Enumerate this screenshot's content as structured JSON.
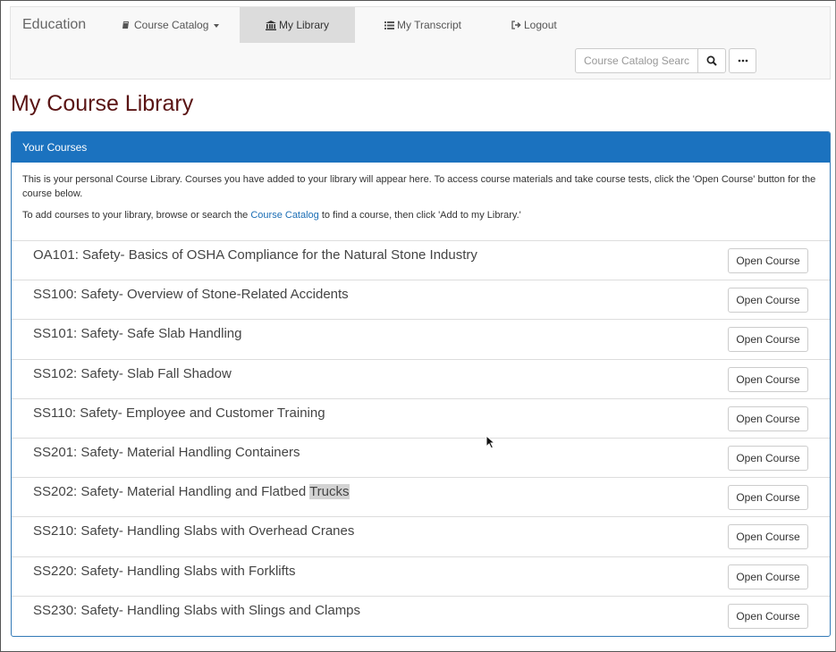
{
  "navbar": {
    "brand": "Education",
    "items": [
      {
        "label": "Course Catalog",
        "icon": "book-icon"
      },
      {
        "label": "My Library",
        "icon": "bank-icon",
        "active": true
      },
      {
        "label": "My Transcript",
        "icon": "list-icon"
      },
      {
        "label": "Logout",
        "icon": "logout-icon"
      }
    ],
    "search": {
      "placeholder": "Course Catalog Search",
      "value": ""
    }
  },
  "page": {
    "title": "My Course Library"
  },
  "panel": {
    "heading": "Your Courses",
    "intro": "This is your personal Course Library. Courses you have added to your library will appear here. To access course materials and take course tests, click the 'Open Course' button for the course below.",
    "add_prefix": "To add courses to your library, browse or search the ",
    "add_link": "Course Catalog",
    "add_suffix": " to find a course, then click 'Add to my Library.'"
  },
  "open_button_label": "Open Course",
  "courses": [
    {
      "title": "OA101: Safety- Basics of OSHA Compliance for the Natural Stone Industry"
    },
    {
      "title": "SS100: Safety- Overview of Stone-Related Accidents"
    },
    {
      "title": "SS101: Safety- Safe Slab Handling"
    },
    {
      "title": "SS102: Safety- Slab Fall Shadow"
    },
    {
      "title": "SS110: Safety- Employee and Customer Training"
    },
    {
      "title": "SS201: Safety- Material Handling Containers"
    },
    {
      "title": "SS202: Safety- Material Handling and Flatbed ",
      "highlight": "Trucks"
    },
    {
      "title": "SS210: Safety- Handling Slabs with Overhead Cranes"
    },
    {
      "title": "SS220: Safety- Handling Slabs with Forklifts"
    },
    {
      "title": "SS230: Safety- Handling Slabs with Slings and Clamps"
    }
  ],
  "colors": {
    "panel_heading": "#1b72bf",
    "title": "#5a1414",
    "link": "#1b6eb5"
  }
}
